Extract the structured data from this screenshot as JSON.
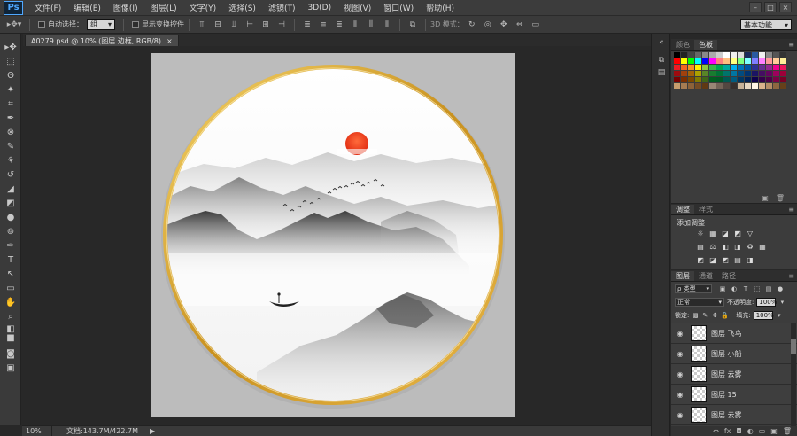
{
  "app": {
    "logo": "Ps"
  },
  "menu": [
    "文件(F)",
    "编辑(E)",
    "图像(I)",
    "图层(L)",
    "文字(Y)",
    "选择(S)",
    "滤镜(T)",
    "3D(D)",
    "视图(V)",
    "窗口(W)",
    "帮助(H)"
  ],
  "window_controls": {
    "minimize": "–",
    "maximize": "□",
    "close": "×"
  },
  "options": {
    "auto_select_label": "自动选择：",
    "auto_select_value": "组",
    "show_transform_label": "显示变换控件",
    "mode_3d_label": "3D 模式：",
    "workspace": "基本功能"
  },
  "document_tab": {
    "title": "A0279.psd @ 10% (图层 边框, RGB/8)",
    "close": "×"
  },
  "status": {
    "zoom": "10%",
    "doc_info": "文档:143.7M/422.7M",
    "arrow": "▶"
  },
  "swatches_panel": {
    "tabs": [
      "颜色",
      "色板"
    ],
    "active": 1
  },
  "swatch_colors": [
    "#000000",
    "#222222",
    "#444444",
    "#666666",
    "#888888",
    "#aaaaaa",
    "#cccccc",
    "#ffffff",
    "#eeeeee",
    "#dddddd",
    "#1a2a5a",
    "#2a5aa0",
    "#f0f0f0",
    "#888888",
    "#555555",
    "#333333",
    "#ff0000",
    "#ffff00",
    "#00ff00",
    "#00ffff",
    "#0000ff",
    "#ff00ff",
    "#ff7f7f",
    "#ffbf7f",
    "#ffff7f",
    "#7fff7f",
    "#7fffff",
    "#7f7fff",
    "#ff7fff",
    "#ff9999",
    "#ffcc99",
    "#ffee99",
    "#ee1c24",
    "#f26522",
    "#f7941d",
    "#fff200",
    "#8dc63f",
    "#39b54a",
    "#00a651",
    "#00a99d",
    "#00aeef",
    "#0072bc",
    "#0054a6",
    "#2e3192",
    "#662d91",
    "#92278f",
    "#ec008c",
    "#ed145b",
    "#9e0b0f",
    "#a0410d",
    "#a36209",
    "#aba000",
    "#598527",
    "#197b30",
    "#007236",
    "#00746b",
    "#0076a3",
    "#004b80",
    "#003471",
    "#1b1464",
    "#440e62",
    "#630460",
    "#9e005d",
    "#9e0039",
    "#790000",
    "#7b2e00",
    "#7d4900",
    "#827b00",
    "#406618",
    "#005e20",
    "#005826",
    "#005952",
    "#005b7f",
    "#003663",
    "#002157",
    "#0d004c",
    "#32004b",
    "#4b0049",
    "#7b0046",
    "#7a0026",
    "#c69c6d",
    "#a67c52",
    "#8c6239",
    "#754c24",
    "#603913",
    "#998675",
    "#736357",
    "#534741",
    "#362f2d",
    "#c7b299",
    "#e6d7c3",
    "#fff5e5",
    "#d9b38c",
    "#b38c66",
    "#8c6640",
    "#66401a"
  ],
  "swatch_footer": {
    "new": "▣",
    "delete": "🗑"
  },
  "adjustments_panel": {
    "tabs": [
      "调整",
      "样式"
    ],
    "active": 0,
    "title": "添加调整",
    "row1": [
      "☼",
      "▦",
      "◪",
      "◩",
      "▽"
    ],
    "row2": [
      "▤",
      "⚖",
      "◧",
      "◨",
      "♻",
      "▦"
    ],
    "row3": [
      "◩",
      "◪",
      "◩",
      "▤",
      "◨"
    ]
  },
  "layers_panel": {
    "tabs": [
      "图层",
      "通道",
      "路径"
    ],
    "active": 0,
    "filter_label": "ρ 类型",
    "filter_icons": [
      "▣",
      "◐",
      "T",
      "⬚",
      "▤",
      "●"
    ],
    "blend_mode": "正常",
    "opacity_label": "不透明度:",
    "opacity_value": "100%",
    "lock_label": "锁定:",
    "lock_icons": [
      "▩",
      "✎",
      "✥",
      "🔒"
    ],
    "fill_label": "填充:",
    "fill_value": "100%",
    "layers": [
      "图层 飞鸟",
      "图层 小船",
      "图层 云雾",
      "图层 15",
      "图层 云雾"
    ],
    "footer_icons": [
      "⇔",
      "fx",
      "◘",
      "◐",
      "▭",
      "▣",
      "🗑"
    ]
  },
  "tools": [
    "▸✥",
    "⬚",
    "ʘ",
    "✦",
    "⌗",
    "✒",
    "⊗",
    "✎",
    "⚘",
    "↺",
    "◢",
    "◩",
    "●",
    "⊚",
    "✑",
    "T",
    "↖",
    "▭",
    "✋",
    "⌕",
    "◧",
    "■",
    "◙",
    "▣"
  ]
}
